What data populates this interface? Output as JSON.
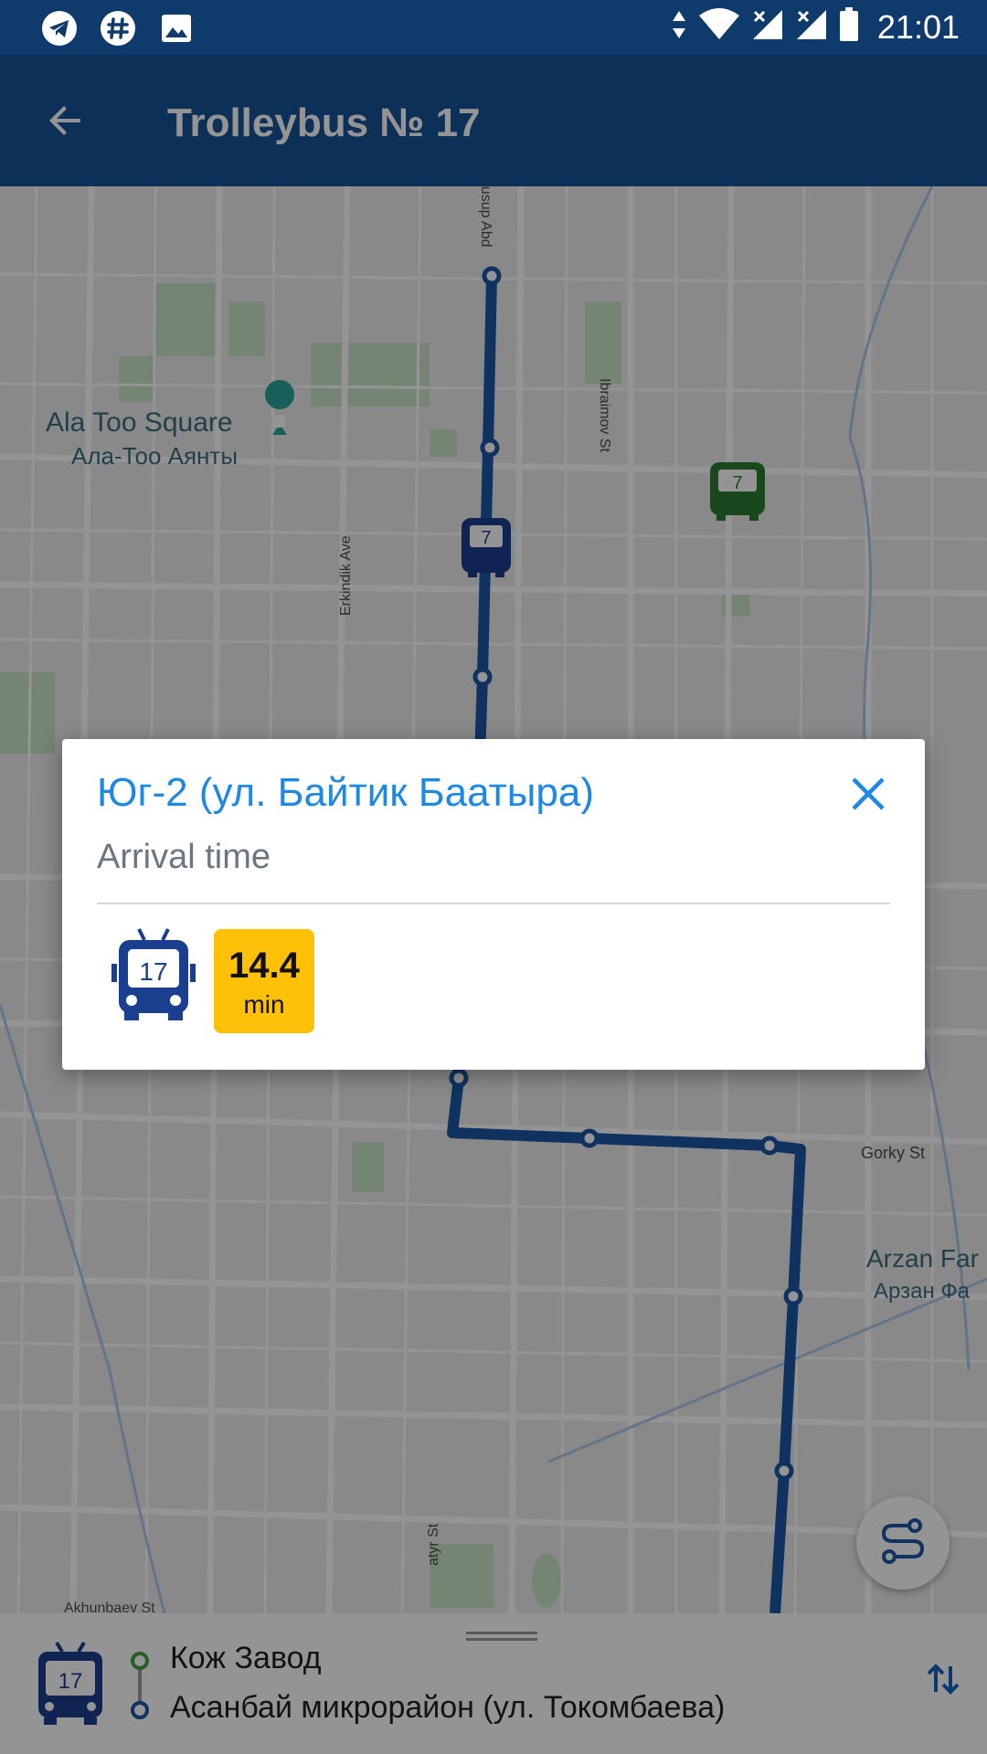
{
  "status_bar": {
    "time": "21:01",
    "left_icons": [
      "telegram-icon",
      "slack-icon",
      "image-icon"
    ],
    "right_icons": [
      "data-arrows-icon",
      "wifi-icon",
      "signal-icon",
      "signal-icon",
      "battery-icon"
    ]
  },
  "app_bar": {
    "title": "Trolleybus № 17",
    "back_icon": "arrow-back-icon"
  },
  "map": {
    "labels": {
      "square_en": "Ala Too Square",
      "square_ru": "Ала-Тоо Аянты",
      "erkindik": "Erkindik Ave",
      "ibraimov": "Ibraimov St",
      "yusup": "Yusup Abd",
      "gorky": "Gorky St",
      "arzan_en": "Arzan Far",
      "arzan_ru": "Арзан Фа",
      "akhunbaev": "Akhunbaev St",
      "batyr": "atyr St"
    },
    "vehicles": [
      {
        "number": "7",
        "color": "#1a3f8f"
      },
      {
        "number": "7",
        "color": "#2e7d32"
      }
    ],
    "route_color": "#1a56a8"
  },
  "popup": {
    "stop_name": "Юг-2 (ул. Байтик Баатыра)",
    "subtitle": "Arrival time",
    "vehicle_number": "17",
    "eta_value": "14.4",
    "eta_unit": "min",
    "eta_color": "#ffc107",
    "title_color": "#1e88e5",
    "close_icon": "close-icon"
  },
  "bottom_sheet": {
    "vehicle_number": "17",
    "from_stop": "Кож Завод",
    "to_stop": "Асанбай микрорайон (ул. Токомбаева)",
    "swap_icon": "swap-vertical-icon"
  },
  "fab": {
    "icon": "route-icon"
  }
}
